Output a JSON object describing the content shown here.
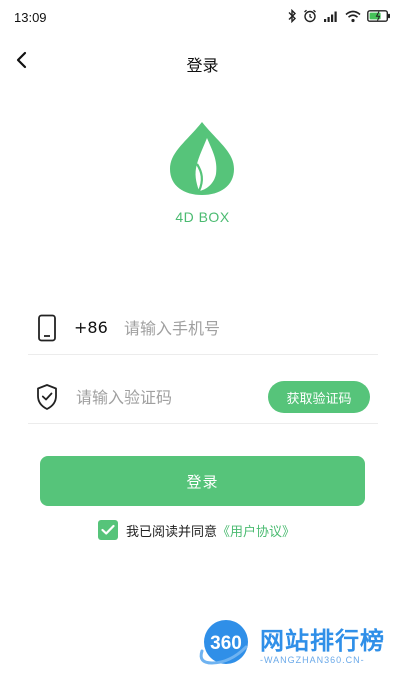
{
  "status_bar": {
    "time": "13:09"
  },
  "header": {
    "title": "登录"
  },
  "brand": {
    "name": "4D BOX",
    "color": "#4bbb71"
  },
  "form": {
    "country_code": "+86",
    "phone_placeholder": "请输入手机号",
    "code_placeholder": "请输入验证码",
    "get_code_label": "获取验证码",
    "login_label": "登录"
  },
  "agreement": {
    "checked": true,
    "text": "我已阅读并同意",
    "link": "《用户协议》"
  },
  "watermark": {
    "logo_text": "360",
    "title": "网站排行榜",
    "subtitle": "-WANGZHAN360.CN-"
  },
  "colors": {
    "accent": "#56c47a",
    "link": "#4bbb71",
    "watermark": "#2f8fe8"
  }
}
